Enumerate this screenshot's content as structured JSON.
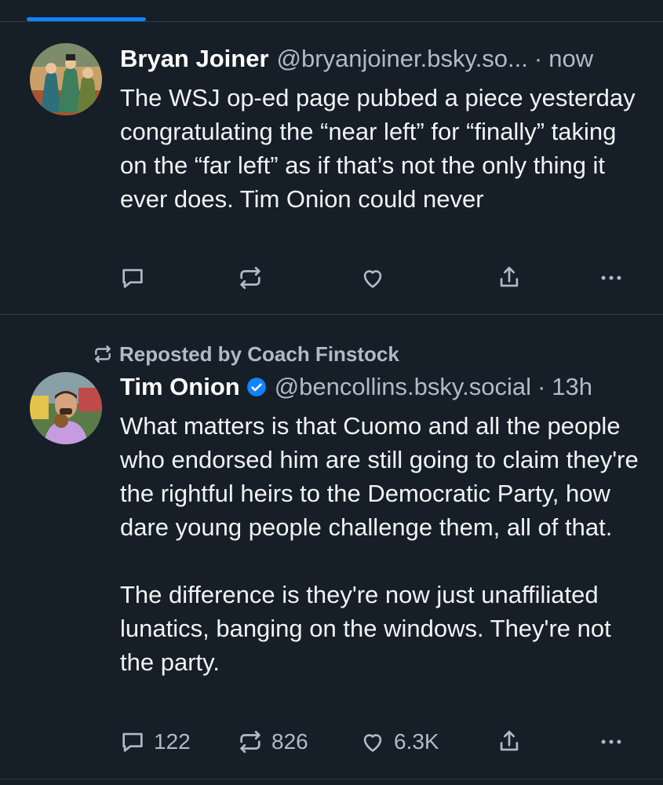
{
  "tab_indicator_color": "#1083fe",
  "posts": [
    {
      "author_name": "Bryan Joiner",
      "handle": "@bryanjoiner.bsky.so...",
      "separator": "·",
      "time": "now",
      "text": "The WSJ op-ed page pubbed a piece yesterday congratulating the “near left” for “finally” taking on the “far left” as if that’s not the only thing it ever does. Tim Onion could never",
      "actions": {
        "reply_icon": "reply-icon",
        "repost_icon": "repost-icon",
        "like_icon": "like-icon",
        "share_icon": "share-icon",
        "more_icon": "more-icon"
      }
    },
    {
      "repost_label": "Reposted by Coach Finstock",
      "author_name": "Tim Onion",
      "verified": true,
      "handle": "@bencollins.bsky.social",
      "separator": "·",
      "time": "13h",
      "text": "What matters is that Cuomo and all the people who endorsed him are still going to claim they're the rightful heirs to the Democratic Party, how dare young people challenge them, all of that.\n\nThe difference is they're now just unaffiliated lunatics, banging on the windows. They're not the party.",
      "actions": {
        "reply_count": "122",
        "repost_count": "826",
        "like_count": "6.3K"
      }
    }
  ]
}
